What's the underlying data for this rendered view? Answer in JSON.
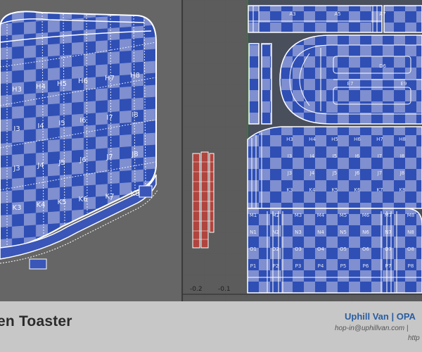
{
  "viewport3d": {
    "checker_labels": [
      "H3",
      "H4",
      "H5",
      "H6",
      "H7",
      "H8",
      "I3",
      "I4",
      "I5",
      "I6",
      "I7",
      "I8",
      "J3",
      "J4",
      "J5",
      "J6",
      "J7",
      "J8",
      "K3",
      "K4",
      "K5",
      "K6",
      "K7",
      "K8"
    ]
  },
  "uv_editor": {
    "axis_ticks": [
      "-0.2",
      "-0.1"
    ],
    "top_strip_labels": [
      "A3",
      "A5",
      "A7"
    ],
    "slot_labels": [
      "D6",
      "E7",
      "E9"
    ],
    "grid_labels": [
      "H3",
      "H4",
      "H5",
      "H6",
      "H7",
      "H8",
      "I3",
      "I4",
      "I5",
      "I6",
      "I7",
      "I8",
      "J3",
      "J4",
      "J5",
      "J6",
      "J7",
      "J8",
      "K3",
      "K4",
      "K5",
      "K6",
      "K7",
      "K8",
      "M1",
      "M2",
      "M3",
      "M4",
      "M5",
      "M6",
      "M7",
      "M8",
      "N1",
      "N2",
      "N3",
      "N4",
      "N5",
      "N6",
      "N7",
      "N8",
      "O1",
      "O2",
      "O3",
      "O4",
      "O5",
      "O6",
      "O7",
      "O8",
      "P1",
      "P2",
      "P3",
      "P4",
      "P5",
      "P6",
      "P7",
      "P8"
    ]
  },
  "footer": {
    "title": "en Toaster",
    "brand": "Uphill Van  |  OPA",
    "contact": "hop-in@uphillvan.com | ",
    "url": "http"
  },
  "colors": {
    "checker_dark": "#2f4fb5",
    "checker_light": "#7f8fcf",
    "wire": "#ffffff",
    "uv_island_red": "#b0443e",
    "brand_blue": "#2a5d9f"
  }
}
